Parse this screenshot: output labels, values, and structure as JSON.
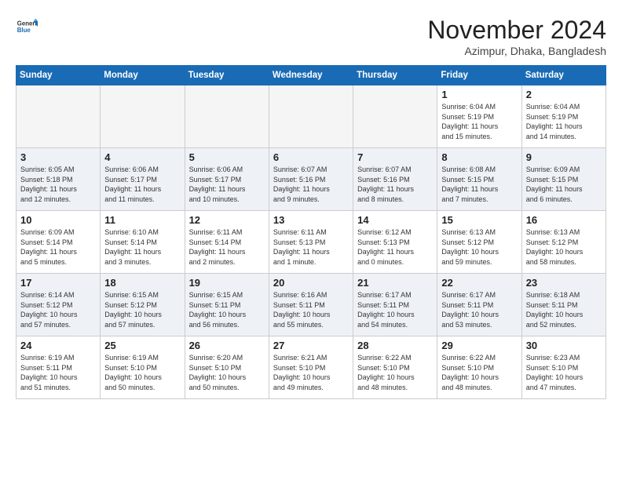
{
  "header": {
    "logo_general": "General",
    "logo_blue": "Blue",
    "month_title": "November 2024",
    "location": "Azimpur, Dhaka, Bangladesh"
  },
  "weekdays": [
    "Sunday",
    "Monday",
    "Tuesday",
    "Wednesday",
    "Thursday",
    "Friday",
    "Saturday"
  ],
  "weeks": [
    [
      {
        "day": "",
        "info": "",
        "empty": true
      },
      {
        "day": "",
        "info": "",
        "empty": true
      },
      {
        "day": "",
        "info": "",
        "empty": true
      },
      {
        "day": "",
        "info": "",
        "empty": true
      },
      {
        "day": "",
        "info": "",
        "empty": true
      },
      {
        "day": "1",
        "info": "Sunrise: 6:04 AM\nSunset: 5:19 PM\nDaylight: 11 hours\nand 15 minutes.",
        "empty": false
      },
      {
        "day": "2",
        "info": "Sunrise: 6:04 AM\nSunset: 5:19 PM\nDaylight: 11 hours\nand 14 minutes.",
        "empty": false
      }
    ],
    [
      {
        "day": "3",
        "info": "Sunrise: 6:05 AM\nSunset: 5:18 PM\nDaylight: 11 hours\nand 12 minutes.",
        "empty": false
      },
      {
        "day": "4",
        "info": "Sunrise: 6:06 AM\nSunset: 5:17 PM\nDaylight: 11 hours\nand 11 minutes.",
        "empty": false
      },
      {
        "day": "5",
        "info": "Sunrise: 6:06 AM\nSunset: 5:17 PM\nDaylight: 11 hours\nand 10 minutes.",
        "empty": false
      },
      {
        "day": "6",
        "info": "Sunrise: 6:07 AM\nSunset: 5:16 PM\nDaylight: 11 hours\nand 9 minutes.",
        "empty": false
      },
      {
        "day": "7",
        "info": "Sunrise: 6:07 AM\nSunset: 5:16 PM\nDaylight: 11 hours\nand 8 minutes.",
        "empty": false
      },
      {
        "day": "8",
        "info": "Sunrise: 6:08 AM\nSunset: 5:15 PM\nDaylight: 11 hours\nand 7 minutes.",
        "empty": false
      },
      {
        "day": "9",
        "info": "Sunrise: 6:09 AM\nSunset: 5:15 PM\nDaylight: 11 hours\nand 6 minutes.",
        "empty": false
      }
    ],
    [
      {
        "day": "10",
        "info": "Sunrise: 6:09 AM\nSunset: 5:14 PM\nDaylight: 11 hours\nand 5 minutes.",
        "empty": false
      },
      {
        "day": "11",
        "info": "Sunrise: 6:10 AM\nSunset: 5:14 PM\nDaylight: 11 hours\nand 3 minutes.",
        "empty": false
      },
      {
        "day": "12",
        "info": "Sunrise: 6:11 AM\nSunset: 5:14 PM\nDaylight: 11 hours\nand 2 minutes.",
        "empty": false
      },
      {
        "day": "13",
        "info": "Sunrise: 6:11 AM\nSunset: 5:13 PM\nDaylight: 11 hours\nand 1 minute.",
        "empty": false
      },
      {
        "day": "14",
        "info": "Sunrise: 6:12 AM\nSunset: 5:13 PM\nDaylight: 11 hours\nand 0 minutes.",
        "empty": false
      },
      {
        "day": "15",
        "info": "Sunrise: 6:13 AM\nSunset: 5:12 PM\nDaylight: 10 hours\nand 59 minutes.",
        "empty": false
      },
      {
        "day": "16",
        "info": "Sunrise: 6:13 AM\nSunset: 5:12 PM\nDaylight: 10 hours\nand 58 minutes.",
        "empty": false
      }
    ],
    [
      {
        "day": "17",
        "info": "Sunrise: 6:14 AM\nSunset: 5:12 PM\nDaylight: 10 hours\nand 57 minutes.",
        "empty": false
      },
      {
        "day": "18",
        "info": "Sunrise: 6:15 AM\nSunset: 5:12 PM\nDaylight: 10 hours\nand 57 minutes.",
        "empty": false
      },
      {
        "day": "19",
        "info": "Sunrise: 6:15 AM\nSunset: 5:11 PM\nDaylight: 10 hours\nand 56 minutes.",
        "empty": false
      },
      {
        "day": "20",
        "info": "Sunrise: 6:16 AM\nSunset: 5:11 PM\nDaylight: 10 hours\nand 55 minutes.",
        "empty": false
      },
      {
        "day": "21",
        "info": "Sunrise: 6:17 AM\nSunset: 5:11 PM\nDaylight: 10 hours\nand 54 minutes.",
        "empty": false
      },
      {
        "day": "22",
        "info": "Sunrise: 6:17 AM\nSunset: 5:11 PM\nDaylight: 10 hours\nand 53 minutes.",
        "empty": false
      },
      {
        "day": "23",
        "info": "Sunrise: 6:18 AM\nSunset: 5:11 PM\nDaylight: 10 hours\nand 52 minutes.",
        "empty": false
      }
    ],
    [
      {
        "day": "24",
        "info": "Sunrise: 6:19 AM\nSunset: 5:11 PM\nDaylight: 10 hours\nand 51 minutes.",
        "empty": false
      },
      {
        "day": "25",
        "info": "Sunrise: 6:19 AM\nSunset: 5:10 PM\nDaylight: 10 hours\nand 50 minutes.",
        "empty": false
      },
      {
        "day": "26",
        "info": "Sunrise: 6:20 AM\nSunset: 5:10 PM\nDaylight: 10 hours\nand 50 minutes.",
        "empty": false
      },
      {
        "day": "27",
        "info": "Sunrise: 6:21 AM\nSunset: 5:10 PM\nDaylight: 10 hours\nand 49 minutes.",
        "empty": false
      },
      {
        "day": "28",
        "info": "Sunrise: 6:22 AM\nSunset: 5:10 PM\nDaylight: 10 hours\nand 48 minutes.",
        "empty": false
      },
      {
        "day": "29",
        "info": "Sunrise: 6:22 AM\nSunset: 5:10 PM\nDaylight: 10 hours\nand 48 minutes.",
        "empty": false
      },
      {
        "day": "30",
        "info": "Sunrise: 6:23 AM\nSunset: 5:10 PM\nDaylight: 10 hours\nand 47 minutes.",
        "empty": false
      }
    ]
  ],
  "colors": {
    "header_bg": "#1a6bb5",
    "alt_row": "#eef2f7",
    "empty_bg": "#f5f5f5"
  }
}
